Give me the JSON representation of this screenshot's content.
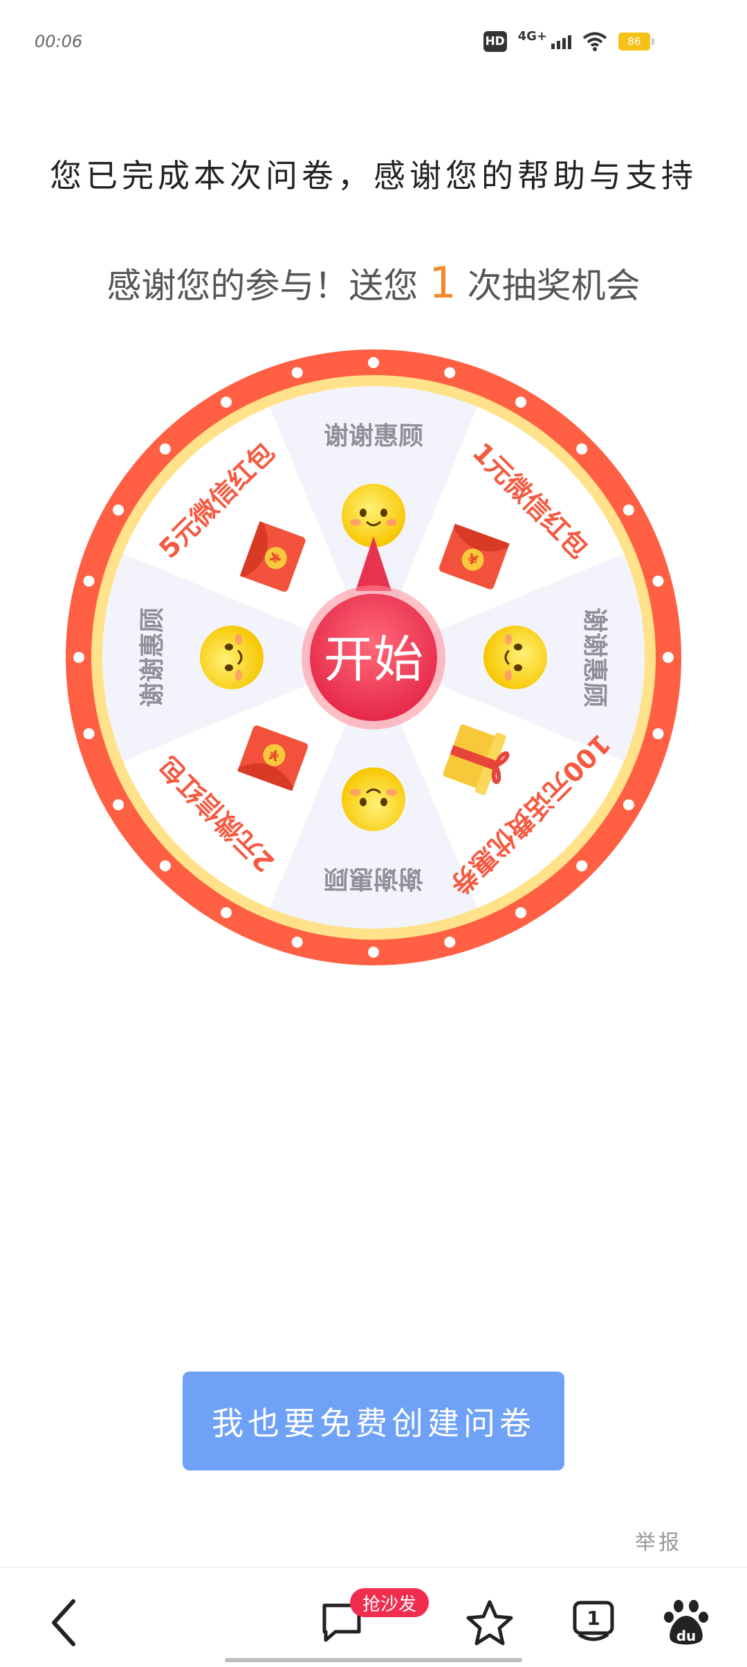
{
  "status_bar": {
    "time": "00:06",
    "hd": "HD",
    "network": "4G+",
    "battery": "86"
  },
  "completion_message": "您已完成本次问卷，感谢您的帮助与支持",
  "thanks": {
    "prefix": "感谢您的参与！送您",
    "count": "1",
    "suffix": "次抽奖机会"
  },
  "wheel": {
    "start_label": "开始",
    "segments": [
      {
        "label": "谢谢惠顾",
        "icon": "smiley-icon"
      },
      {
        "label": "1元微信红包",
        "icon": "red-envelope-icon"
      },
      {
        "label": "谢谢惠顾",
        "icon": "smiley-icon"
      },
      {
        "label": "100元话费优惠券",
        "icon": "gift-box-icon"
      },
      {
        "label": "谢谢惠顾",
        "icon": "smiley-icon"
      },
      {
        "label": "2元微信红包",
        "icon": "red-envelope-icon"
      },
      {
        "label": "谢谢惠顾",
        "icon": "smiley-icon"
      },
      {
        "label": "5元微信红包",
        "icon": "red-envelope-icon"
      }
    ],
    "colors": {
      "rim": "#ff5f43",
      "inner_ring": "#ffe28a",
      "segment_light": "#f3f3fb",
      "segment_white": "#ffffff",
      "prize_text": "#f45a40",
      "thanks_text": "#8f8f9a",
      "button": "#e8334f"
    }
  },
  "create_button": "我也要免费创建问卷",
  "report_link": "举报",
  "bottom_nav": {
    "back": "back-icon",
    "comment": "comment-icon",
    "comment_badge": "抢沙发",
    "favorite": "star-icon",
    "tab_count": "1",
    "baidu": "du"
  }
}
